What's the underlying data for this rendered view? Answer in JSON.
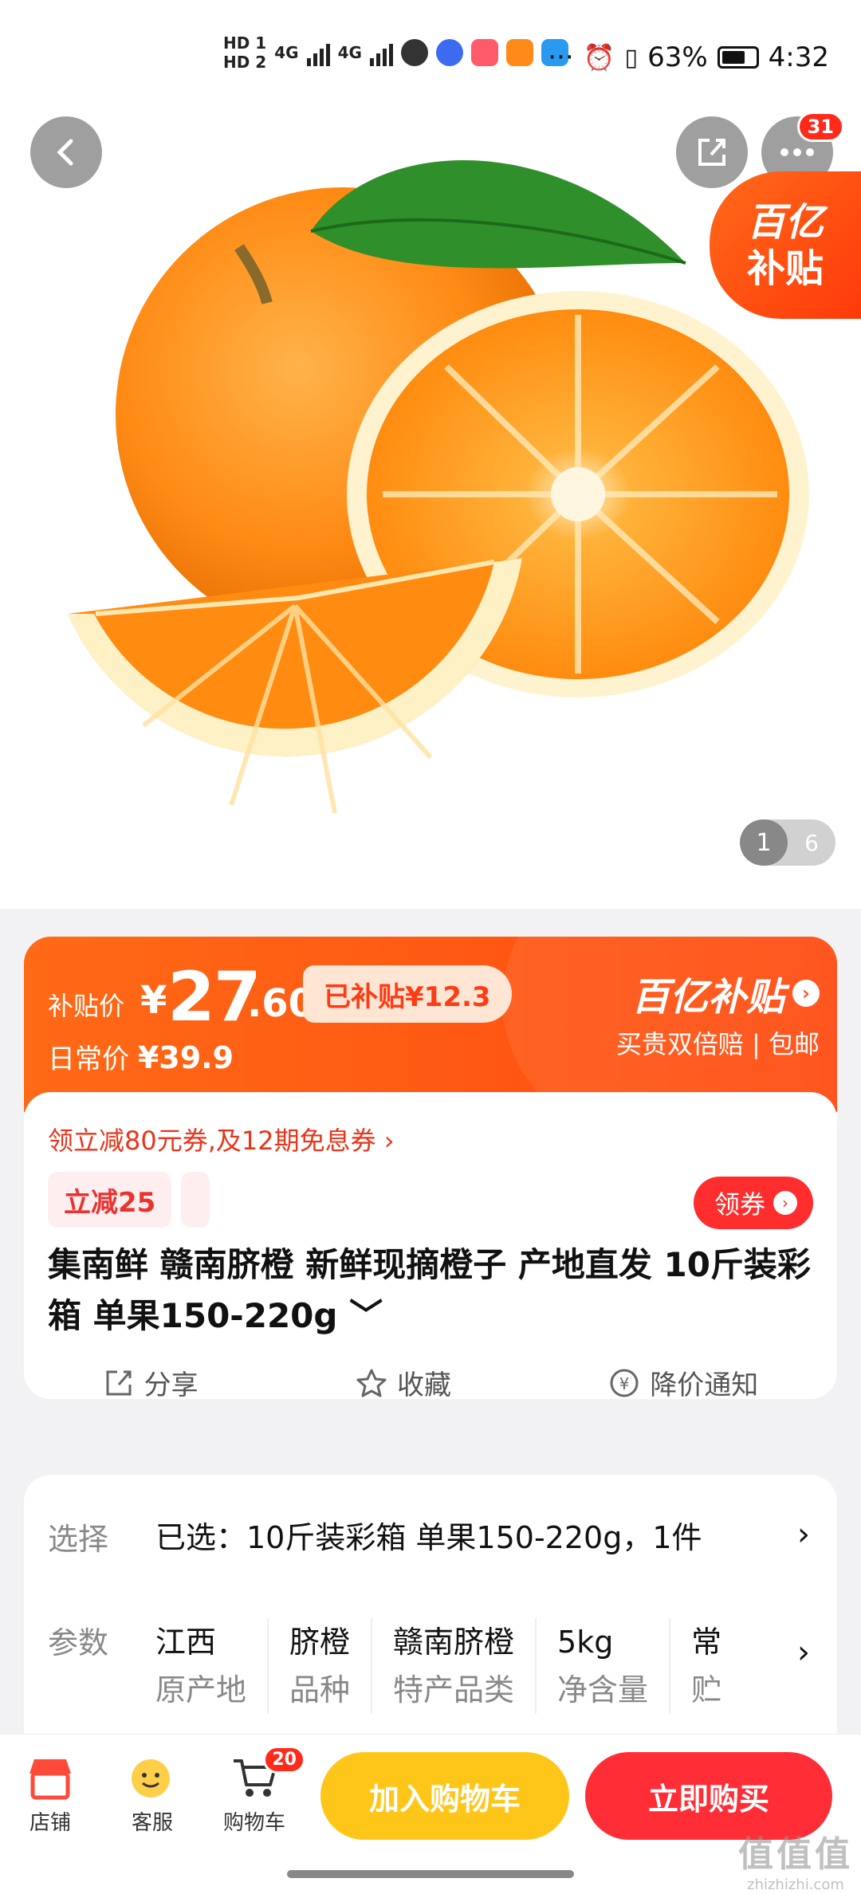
{
  "status_bar": {
    "hd1": "HD 1",
    "hd2": "HD 2",
    "net1": "4G",
    "net2": "4G",
    "dots": "···",
    "battery_pct": "63%",
    "time": "4:32"
  },
  "hero": {
    "more_badge": "31",
    "subsidy_badge_line1": "百亿",
    "subsidy_badge_line2": "补贴",
    "page_current": "1",
    "page_total": "6"
  },
  "price": {
    "subsidy_label": "补贴价",
    "currency": "¥",
    "price_int": "27",
    "price_dec": ".60",
    "subsidized": "已补贴¥12.3",
    "daily_label": "日常价",
    "daily_value": "¥39.9",
    "brand": "百亿补贴",
    "brand_sub": "买贵双倍赔 | 包邮"
  },
  "coupon": {
    "line": "领立减80元券,及12期免息券 ›",
    "tag1": "立减25",
    "get_coupon": "领券"
  },
  "product": {
    "title": "集南鲜 赣南脐橙 新鲜现摘橙子 产地直发 10斤装彩箱 单果150-220g ﹀"
  },
  "actions": {
    "share": "分享",
    "favorite": "收藏",
    "price_alert": "降价通知"
  },
  "spec": {
    "select_label": "选择",
    "select_value": "已选：10斤装彩箱 单果150-220g，1件",
    "params_label": "参数",
    "params": [
      {
        "value": "江西",
        "key": "原产地"
      },
      {
        "value": "脐橙",
        "key": "品种"
      },
      {
        "value": "赣南脐橙",
        "key": "特产品类"
      },
      {
        "value": "5kg",
        "key": "净含量"
      },
      {
        "value": "常",
        "key": "贮"
      }
    ]
  },
  "bottom": {
    "store": "店铺",
    "service": "客服",
    "cart": "购物车",
    "cart_count": "20",
    "add_to_cart": "加入购物车",
    "buy_now": "立即购买"
  },
  "watermark": {
    "main": "值值值",
    "url": "zhizhizhi.com"
  },
  "colors": {
    "accent": "#ff4a10",
    "cart_button": "#ffc61a",
    "buy_button": "#ff2d36"
  }
}
